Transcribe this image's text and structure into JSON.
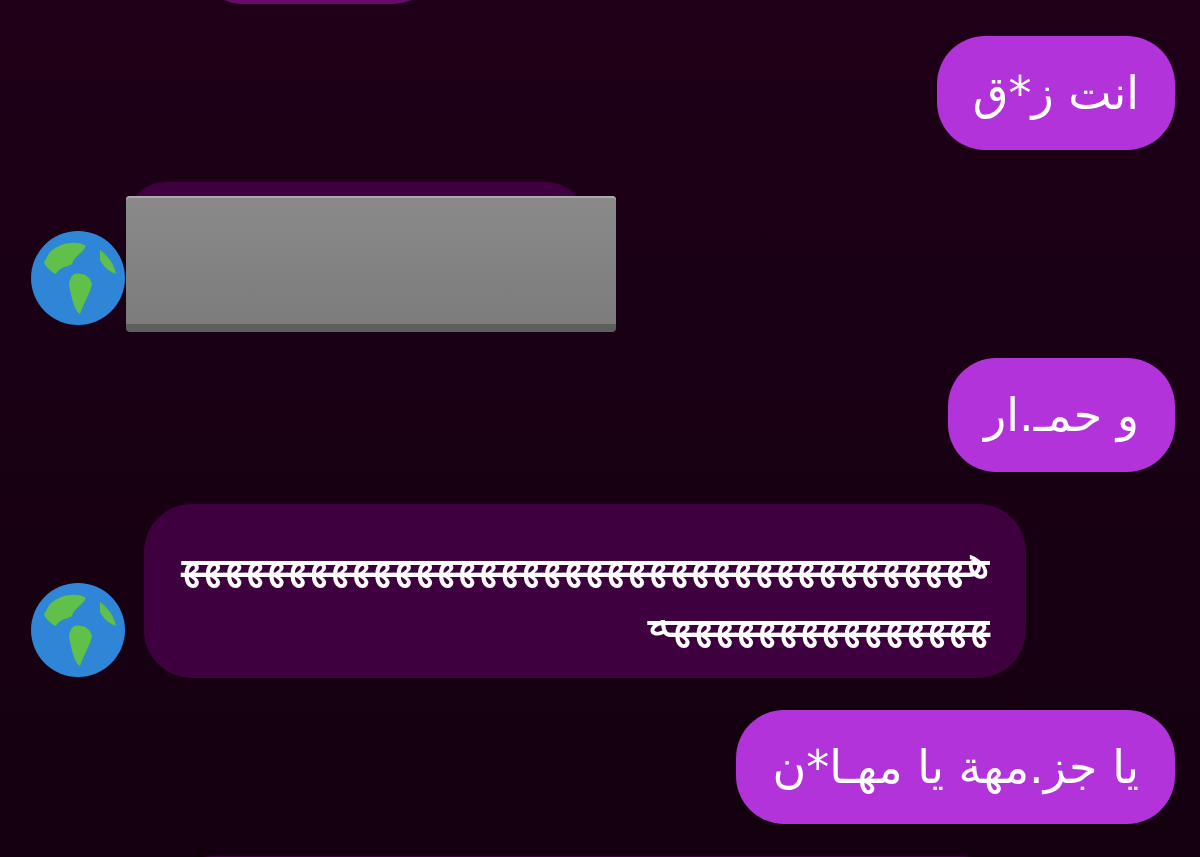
{
  "messages": [
    {
      "kind": "partial_received"
    },
    {
      "kind": "sent",
      "text": "انت ز*ق",
      "struck": false
    },
    {
      "kind": "redacted_received"
    },
    {
      "kind": "sent",
      "text": "و حمـ.ار",
      "struck": false
    },
    {
      "kind": "received",
      "text": "هههههههههههههههههههههههههههههههههههههههههههههههههههههه",
      "struck": true
    },
    {
      "kind": "sent",
      "text": "يا جز.مهة يا مهـا*ن",
      "struck": false
    },
    {
      "kind": "partial_received"
    }
  ]
}
